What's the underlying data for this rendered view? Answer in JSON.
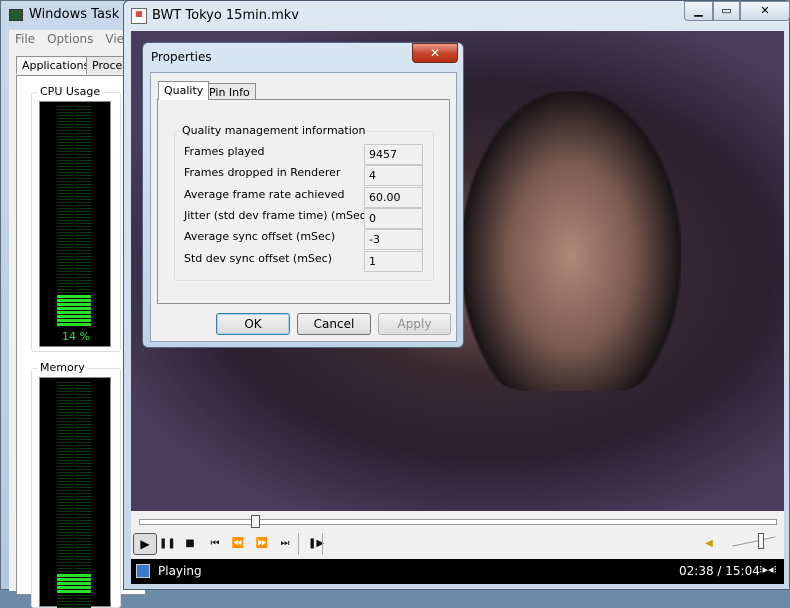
{
  "task_manager": {
    "title": "Windows Task Ma",
    "menu": [
      "File",
      "Options",
      "View"
    ],
    "tabs": [
      "Applications",
      "Processes"
    ],
    "cpu_label": "CPU Usage",
    "cpu_percent": "14 %",
    "cpu_value": 14,
    "memory_label": "Memory"
  },
  "player": {
    "title": "BWT Tokyo 15min.mkv",
    "window_buttons": [
      "minimize",
      "maximize"
    ],
    "seek_fraction": 0.175,
    "volume_fraction": 0.6,
    "status": "Playing",
    "time": "02:38 / 15:04",
    "controls": [
      "play",
      "pause",
      "stop",
      "previous",
      "rewind",
      "fast-forward",
      "next",
      "frame-step"
    ]
  },
  "dialog": {
    "title": "Properties",
    "close": "✕",
    "tabs": [
      "Quality",
      "Pin Info"
    ],
    "group_title": "Quality management information",
    "rows": [
      {
        "label": "Frames played",
        "value": "9457"
      },
      {
        "label": "Frames dropped in Renderer",
        "value": "4"
      },
      {
        "label": "Average frame rate achieved",
        "value": "60.00"
      },
      {
        "label": "Jitter (std dev frame time) (mSec)",
        "value": "0"
      },
      {
        "label": "Average sync offset (mSec)",
        "value": "-3"
      },
      {
        "label": "Std dev sync offset (mSec)",
        "value": "1"
      }
    ],
    "buttons": {
      "ok": "OK",
      "cancel": "Cancel",
      "apply": "Apply"
    }
  }
}
